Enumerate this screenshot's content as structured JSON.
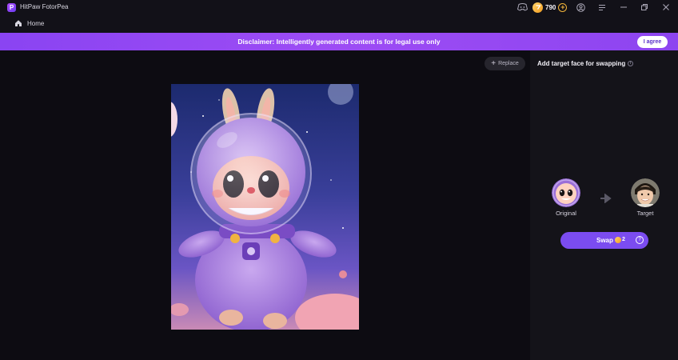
{
  "app": {
    "name": "HitPaw FotorPea",
    "logo_letter": "P"
  },
  "titlebar": {
    "coins": "790",
    "icons": [
      "discord-icon",
      "coin-icon",
      "add-coins-icon",
      "account-icon",
      "menu-icon",
      "minimize-icon",
      "restore-icon",
      "close-icon"
    ]
  },
  "nav": {
    "home_label": "Home"
  },
  "disclaimer": {
    "text": "Disclaimer: Intelligently generated content is for legal use only",
    "agree_label": "I agree"
  },
  "main": {
    "replace_label": "Replace"
  },
  "panel": {
    "title": "Add target face for swapping",
    "original_label": "Original",
    "target_label": "Target",
    "swap_label": "Swap",
    "swap_cost": "2"
  },
  "colors": {
    "accent": "#7b4cf0",
    "banner": "#9a4af3",
    "background": "#0d0c12",
    "panel": "#141319"
  }
}
